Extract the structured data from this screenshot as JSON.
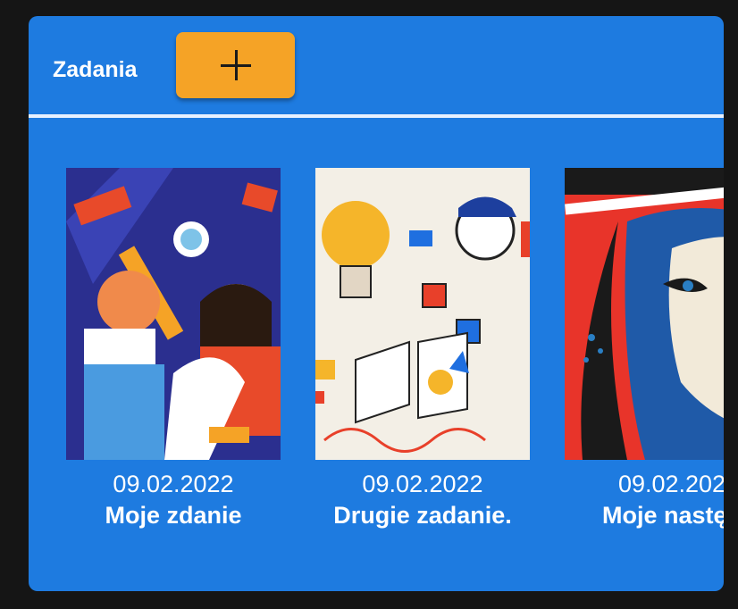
{
  "section": {
    "title": "Zadania",
    "add_button_icon": "plus-icon"
  },
  "colors": {
    "panel": "#1e7be0",
    "accent": "#f5a326",
    "background": "#151515"
  },
  "tasks": [
    {
      "date": "09.02.2022",
      "name": "Moje zdanie",
      "image": "abstract-people-illustration"
    },
    {
      "date": "09.02.2022",
      "name": "Drugie zadanie.",
      "image": "lightbulb-character-illustration"
    },
    {
      "date": "09.02.202",
      "name": "Moje nastęр",
      "image": "pop-art-face-illustration"
    }
  ]
}
